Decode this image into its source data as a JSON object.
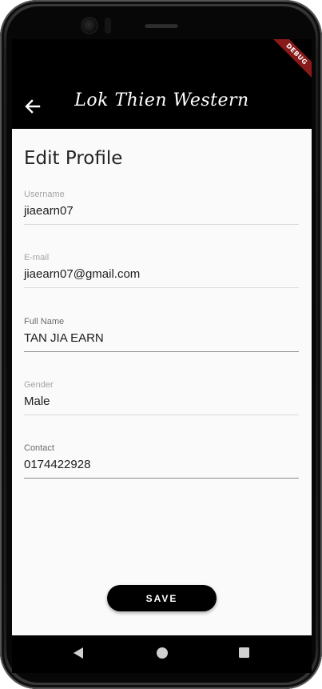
{
  "app": {
    "title": "Lok Thien Western",
    "debug_banner": "DEBUG"
  },
  "page": {
    "title": "Edit Profile"
  },
  "fields": [
    {
      "label": "Username",
      "value": "jiaearn07"
    },
    {
      "label": "E-mail",
      "value": "jiaearn07@gmail.com"
    },
    {
      "label": "Full Name",
      "value": "TAN JIA EARN"
    },
    {
      "label": "Gender",
      "value": "Male"
    },
    {
      "label": "Contact",
      "value": "0174422928"
    }
  ],
  "actions": {
    "save_label": "SAVE"
  },
  "icons": {
    "back": "arrow-left-icon",
    "nav_back": "triangle-back-icon",
    "nav_home": "circle-home-icon",
    "nav_recent": "square-recent-icon"
  },
  "colors": {
    "appbar": "#000000",
    "background": "#fafafa",
    "debug_banner": "#8a1a1a",
    "button": "#000000"
  }
}
